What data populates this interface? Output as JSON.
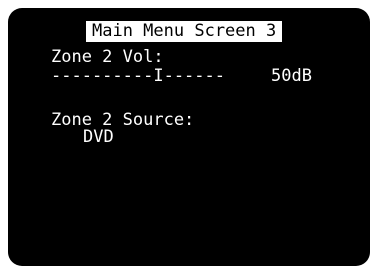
{
  "title": "Main Menu Screen 3",
  "zone2_volume": {
    "label": "Zone 2 Vol:",
    "bar": "----------I------",
    "level": 0.625,
    "value": "50dB"
  },
  "zone2_source": {
    "label": "Zone 2 Source:",
    "value": "DVD"
  },
  "colors": {
    "screen_background": "#000000",
    "text": "#ffffff",
    "title_highlight": "#ffffff"
  }
}
